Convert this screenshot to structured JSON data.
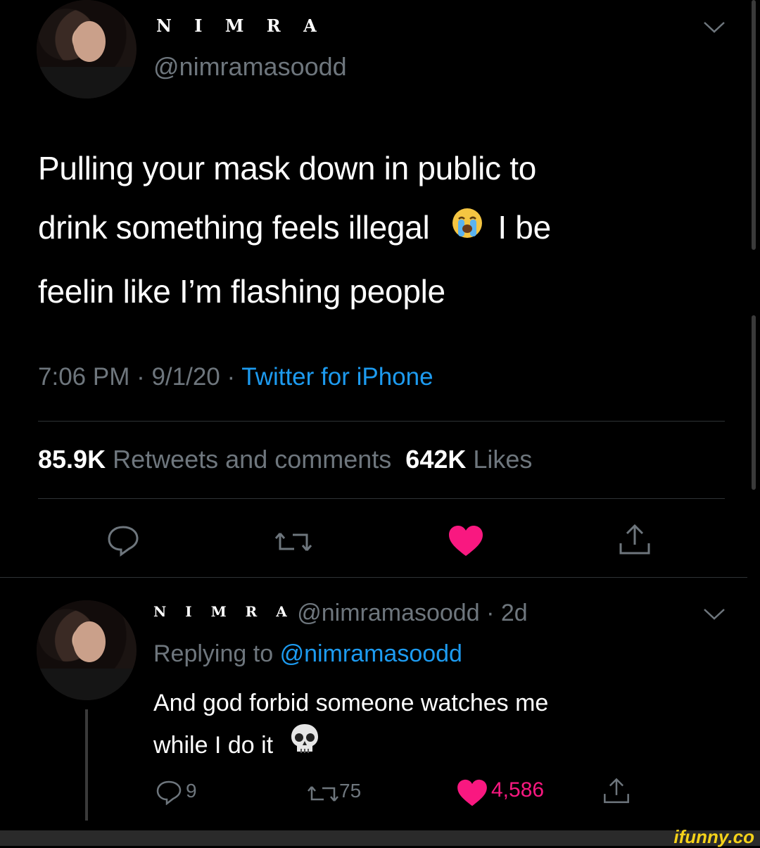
{
  "tweet": {
    "display_name": "N I M R A",
    "handle": "@nimramasoodd",
    "text_line1": "Pulling your mask down in public to",
    "text_line2_a": "drink something feels illegal",
    "text_line2_b": "I be",
    "text_line3": "feelin like I’m flashing people",
    "emoji_name": "loudly-crying-face",
    "time_date": "7:06 PM · 9/1/20 · ",
    "source": "Twitter for iPhone",
    "retweets_count": "85.9K",
    "retweets_label": "Retweets and comments",
    "likes_count": "642K",
    "likes_label": "Likes",
    "icons": [
      "chevron-down-icon",
      "reply-icon",
      "retweet-icon",
      "heart-icon",
      "share-icon"
    ]
  },
  "reply": {
    "display_name": "N I M R A",
    "handle_age": "@nimramasoodd · 2d",
    "replying_label": "Replying to",
    "replying_handle": "@nimramasoodd",
    "text_line1": "And god forbid someone watches me",
    "text_line2": "while I do it",
    "emoji_name": "skull",
    "reply_count": "9",
    "retweet_count": "75",
    "like_count": "4,586"
  },
  "watermark": "ifunny.co",
  "colors": {
    "background": "#000000",
    "muted": "#6e767d",
    "link": "#1d9bf0",
    "heart": "#f91880",
    "divider": "#2f3336"
  }
}
